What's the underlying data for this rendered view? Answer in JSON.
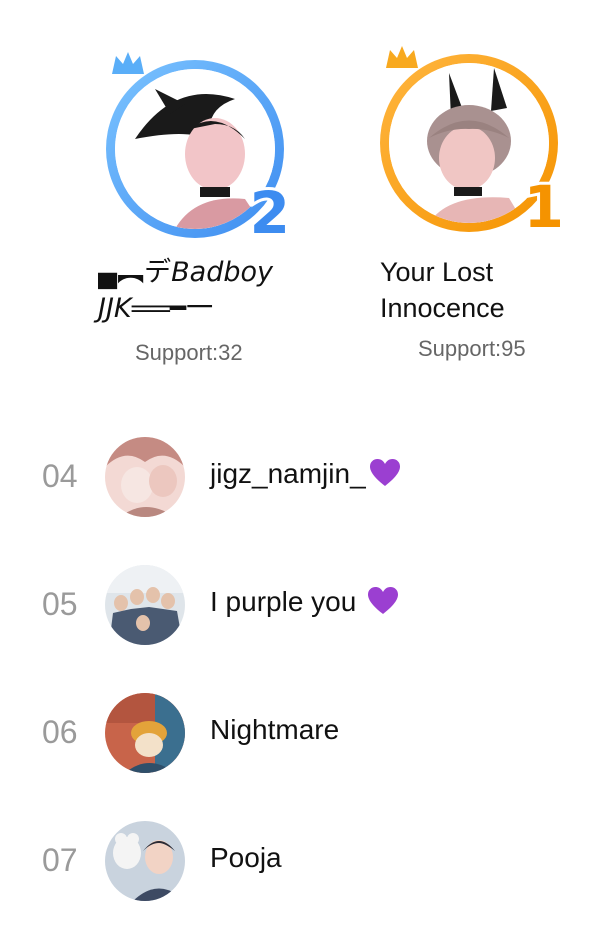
{
  "leaderboard": {
    "top": [
      {
        "rank": "2",
        "name": "▄︻デ𝘉𝘢𝘥𝘣𝘰𝘺 𝘑𝘑𝘒══━一",
        "support": "Support:32",
        "ring_color": "#3d8cf0"
      },
      {
        "rank": "1",
        "name": "Your Lost Innocence",
        "support": "Support:95",
        "ring_color": "#f59300"
      }
    ],
    "items": [
      {
        "rank": "04",
        "name": "jigz_namjin_",
        "badge_icon": "purple-heart-icon"
      },
      {
        "rank": "05",
        "name": "I purple you ",
        "badge_icon": "purple-heart-icon"
      },
      {
        "rank": "06",
        "name": "Nightmare"
      },
      {
        "rank": "07",
        "name": "Pooja"
      }
    ]
  }
}
